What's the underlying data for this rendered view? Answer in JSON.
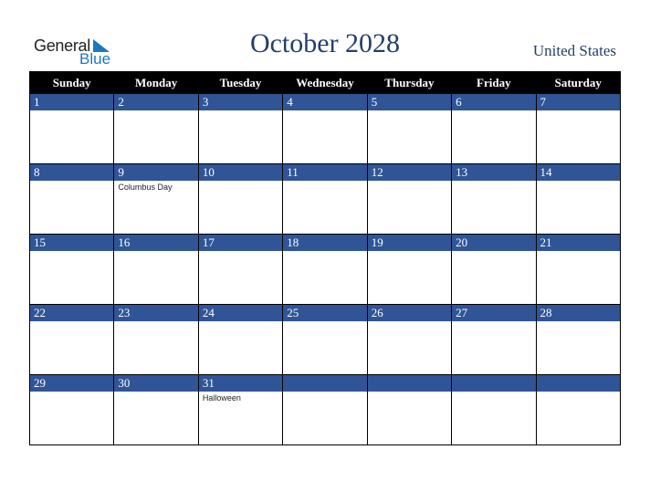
{
  "brand": {
    "line1": "General",
    "line2": "Blue",
    "accent": "#1b78c2"
  },
  "header": {
    "title": "October 2028",
    "country": "United States"
  },
  "colors": {
    "day_header_bg": "#000000",
    "date_strip_bg": "#2f5597",
    "title_text": "#243f6b"
  },
  "days": [
    "Sunday",
    "Monday",
    "Tuesday",
    "Wednesday",
    "Thursday",
    "Friday",
    "Saturday"
  ],
  "weeks": [
    [
      {
        "d": "1",
        "h": ""
      },
      {
        "d": "2",
        "h": ""
      },
      {
        "d": "3",
        "h": ""
      },
      {
        "d": "4",
        "h": ""
      },
      {
        "d": "5",
        "h": ""
      },
      {
        "d": "6",
        "h": ""
      },
      {
        "d": "7",
        "h": ""
      }
    ],
    [
      {
        "d": "8",
        "h": ""
      },
      {
        "d": "9",
        "h": "Columbus Day"
      },
      {
        "d": "10",
        "h": ""
      },
      {
        "d": "11",
        "h": ""
      },
      {
        "d": "12",
        "h": ""
      },
      {
        "d": "13",
        "h": ""
      },
      {
        "d": "14",
        "h": ""
      }
    ],
    [
      {
        "d": "15",
        "h": ""
      },
      {
        "d": "16",
        "h": ""
      },
      {
        "d": "17",
        "h": ""
      },
      {
        "d": "18",
        "h": ""
      },
      {
        "d": "19",
        "h": ""
      },
      {
        "d": "20",
        "h": ""
      },
      {
        "d": "21",
        "h": ""
      }
    ],
    [
      {
        "d": "22",
        "h": ""
      },
      {
        "d": "23",
        "h": ""
      },
      {
        "d": "24",
        "h": ""
      },
      {
        "d": "25",
        "h": ""
      },
      {
        "d": "26",
        "h": ""
      },
      {
        "d": "27",
        "h": ""
      },
      {
        "d": "28",
        "h": ""
      }
    ],
    [
      {
        "d": "29",
        "h": ""
      },
      {
        "d": "30",
        "h": ""
      },
      {
        "d": "31",
        "h": "Halloween"
      },
      {
        "d": "",
        "h": ""
      },
      {
        "d": "",
        "h": ""
      },
      {
        "d": "",
        "h": ""
      },
      {
        "d": "",
        "h": ""
      }
    ]
  ]
}
